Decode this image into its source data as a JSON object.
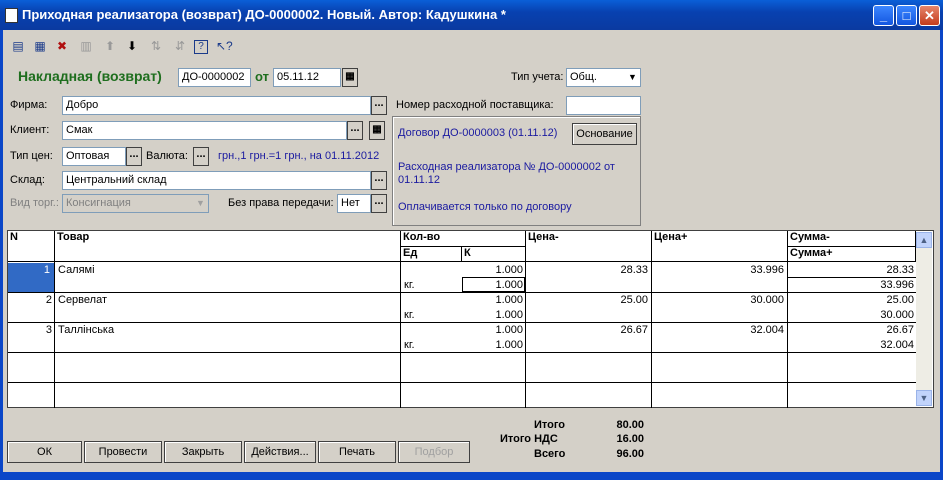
{
  "window": {
    "title": "Приходная реализатора (возврат) ДО-0000002. Новый. Автор: Кадушкина *",
    "min": "_",
    "max": "□",
    "close": "✕"
  },
  "toolbar": [
    "new-row",
    "copy-row",
    "delete-row",
    "edit-row",
    "move-up",
    "move-down",
    "sort-asc",
    "sort-desc",
    "help",
    "whats-this"
  ],
  "header": {
    "doc_title": "Накладная (возврат)",
    "doc_number": "ДО-0000002",
    "from_label": "от",
    "doc_date": "05.11.12",
    "uchet_label": "Тип учета:",
    "uchet_value": "Общ."
  },
  "form": {
    "firma_label": "Фирма:",
    "firma_value": "Добро",
    "client_label": "Клиент:",
    "client_value": "Смак",
    "price_type_label": "Тип цен:",
    "price_type_value": "Оптовая",
    "currency_label": "Валюта:",
    "currency_info": "грн.,1 грн.=1 грн., на 01.11.2012",
    "warehouse_label": "Склад:",
    "warehouse_value": "Центральний склад",
    "trade_kind_label": "Вид торг.:",
    "trade_kind_value": "Консигнация",
    "no_transfer_label": "Без права передачи:",
    "no_transfer_value": "Нет",
    "supplier_no_label": "Номер расходной поставщика:",
    "supplier_no_value": ""
  },
  "info": {
    "contract": "Договор ДО-0000003 (01.11.12)",
    "basis_button": "Основание",
    "sale_ref": "Расходная реализатора № ДО-0000002 от 01.11.12",
    "payment_note": "Оплачивается только по договору"
  },
  "table": {
    "headers": {
      "n": "N",
      "product": "Товар",
      "qty": "Кол-во",
      "unit": "Ед",
      "k": "К",
      "price_minus": "Цена-",
      "price_plus": "Цена+",
      "sum_minus": "Сумма-",
      "sum_plus": "Сумма+"
    },
    "rows": [
      {
        "n": "1",
        "product": "Салямі",
        "qty": "1.000",
        "unit": "кг.",
        "k": "1.000",
        "price_minus": "28.33",
        "price_plus": "33.996",
        "sum_minus": "28.33",
        "sum_plus": "33.996"
      },
      {
        "n": "2",
        "product": "Сервелат",
        "qty": "1.000",
        "unit": "кг.",
        "k": "1.000",
        "price_minus": "25.00",
        "price_plus": "30.000",
        "sum_minus": "25.00",
        "sum_plus": "30.000"
      },
      {
        "n": "3",
        "product": "Таллінська",
        "qty": "1.000",
        "unit": "кг.",
        "k": "1.000",
        "price_minus": "26.67",
        "price_plus": "32.004",
        "sum_minus": "26.67",
        "sum_plus": "32.004"
      }
    ]
  },
  "totals": {
    "itogo_label": "Итого",
    "itogo_value": "80.00",
    "vat_label": "Итого НДС",
    "vat_value": "16.00",
    "all_label": "Всего",
    "all_value": "96.00"
  },
  "buttons": {
    "ok": "ОК",
    "post": "Провести",
    "close": "Закрыть",
    "actions": "Действия...",
    "print": "Печать",
    "select": "Подбор"
  }
}
